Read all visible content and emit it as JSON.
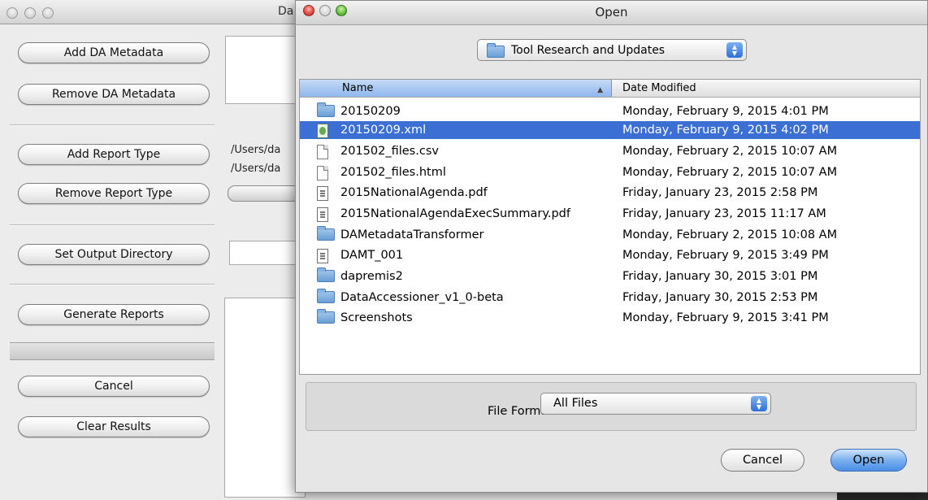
{
  "background_app": {
    "title_fragment": "Da",
    "buttons": {
      "add_metadata": "Add DA Metadata",
      "remove_metadata": "Remove DA Metadata",
      "add_report_type": "Add Report Type",
      "remove_report_type": "Remove Report Type",
      "set_output_directory": "Set Output Directory",
      "generate_reports": "Generate Reports",
      "cancel": "Cancel",
      "clear_results": "Clear Results"
    },
    "report_paths": [
      "/Users/da",
      "/Users/da"
    ]
  },
  "dialog": {
    "title": "Open",
    "folder_popup": {
      "selected": "Tool Research and Updates"
    },
    "columns": {
      "name": "Name",
      "date_modified": "Date Modified"
    },
    "files": [
      {
        "name": "20150209",
        "date": "Monday, February 9, 2015 4:01 PM",
        "icon": "folder-icon"
      },
      {
        "name": "20150209.xml",
        "date": "Monday, February 9, 2015 4:02 PM",
        "icon": "xml-file-icon",
        "selected": true
      },
      {
        "name": "201502_files.csv",
        "date": "Monday, February 2, 2015 10:07 AM",
        "icon": "document-icon"
      },
      {
        "name": "201502_files.html",
        "date": "Monday, February 2, 2015 10:07 AM",
        "icon": "document-icon"
      },
      {
        "name": "2015NationalAgenda.pdf",
        "date": "Friday, January 23, 2015 2:58 PM",
        "icon": "pdf-icon"
      },
      {
        "name": "2015NationalAgendaExecSummary.pdf",
        "date": "Friday, January 23, 2015 11:17 AM",
        "icon": "pdf-icon"
      },
      {
        "name": "DAMetadataTransformer",
        "date": "Monday, February 2, 2015 10:08 AM",
        "icon": "folder-icon"
      },
      {
        "name": "DAMT_001",
        "date": "Monday, February 9, 2015 3:49 PM",
        "icon": "pdf-icon"
      },
      {
        "name": "dapremis2",
        "date": "Friday, January 30, 2015 3:01 PM",
        "icon": "folder-icon"
      },
      {
        "name": "DataAccessioner_v1_0-beta",
        "date": "Friday, January 30, 2015 2:53 PM",
        "icon": "folder-icon"
      },
      {
        "name": "Screenshots",
        "date": "Monday, February 9, 2015 3:41 PM",
        "icon": "folder-icon"
      }
    ],
    "file_format": {
      "label": "File Format:",
      "selected": "All Files"
    },
    "buttons": {
      "cancel": "Cancel",
      "open": "Open"
    },
    "colors": {
      "selection": "#3b6fd4",
      "default_button": "#4a8ee6"
    }
  }
}
